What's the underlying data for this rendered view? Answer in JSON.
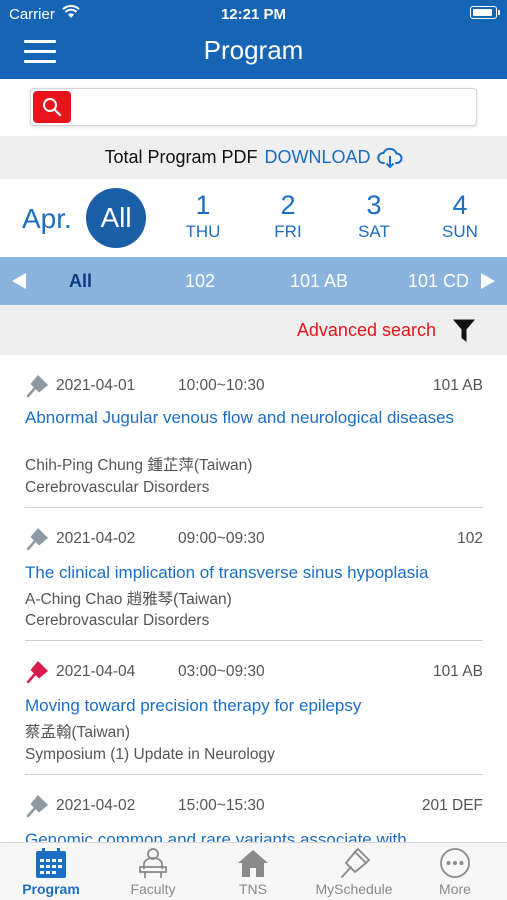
{
  "status_bar": {
    "carrier": "Carrier",
    "time": "12:21 PM"
  },
  "header": {
    "title": "Program"
  },
  "search": {
    "placeholder": "",
    "value": ""
  },
  "pdf": {
    "label": "Total Program PDF",
    "link": "DOWNLOAD"
  },
  "dates": {
    "month": "Apr.",
    "all": "All",
    "days": [
      {
        "num": "1",
        "dow": "THU"
      },
      {
        "num": "2",
        "dow": "FRI"
      },
      {
        "num": "3",
        "dow": "SAT"
      },
      {
        "num": "4",
        "dow": "SUN"
      }
    ]
  },
  "rooms": [
    "All",
    "102",
    "101 AB",
    "101 CD"
  ],
  "advanced_search": {
    "label": "Advanced search"
  },
  "sessions": [
    {
      "pinned": false,
      "date": "2021-04-01",
      "time": "10:00~10:30",
      "room": "101 AB",
      "title": "Abnormal Jugular venous flow and neurological diseases",
      "speaker": "Chih-Ping Chung 鍾芷萍(Taiwan)",
      "category": "Cerebrovascular Disorders"
    },
    {
      "pinned": false,
      "date": "2021-04-02",
      "time": "09:00~09:30",
      "room": "102",
      "title": "The clinical implication of transverse sinus hypoplasia",
      "speaker": "A-Ching Chao 趙雅琴(Taiwan)",
      "category": "Cerebrovascular Disorders"
    },
    {
      "pinned": true,
      "date": "2021-04-04",
      "time": "03:00~09:30",
      "room": "101 AB",
      "title": "Moving toward precision therapy for epilepsy",
      "speaker": "蔡孟翰(Taiwan)",
      "category": "Symposium (1) Update in Neurology"
    },
    {
      "pinned": false,
      "date": "2021-04-02",
      "time": "15:00~15:30",
      "room": "201 DEF",
      "title": "Genomic common and rare variants associate with",
      "speaker": "",
      "category": ""
    }
  ],
  "tabs": [
    {
      "label": "Program",
      "icon": "calendar-icon",
      "active": true
    },
    {
      "label": "Faculty",
      "icon": "faculty-icon",
      "active": false
    },
    {
      "label": "TNS",
      "icon": "home-icon",
      "active": false
    },
    {
      "label": "MySchedule",
      "icon": "pin-icon",
      "active": false
    },
    {
      "label": "More",
      "icon": "more-icon",
      "active": false
    }
  ],
  "colors": {
    "primary": "#1565b4",
    "link": "#1a6fc4",
    "accent_red": "#e8141b",
    "room_bar": "#8ab3dd",
    "pin_gray": "#8d9aa3",
    "pin_red": "#d81b4c"
  }
}
